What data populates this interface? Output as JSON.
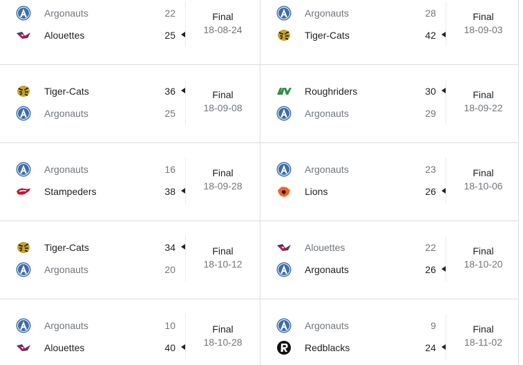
{
  "colors": {
    "divider": "#dadce0",
    "winner_text": "#202124",
    "loser_text": "#70757a",
    "argonauts_blue": "#3b6ea8",
    "alouettes_red": "#c8102e",
    "alouettes_blue": "#2a3b8f",
    "tigercats_gold": "#c9a227",
    "roughriders_green": "#2f8f46",
    "stampeders_red": "#c8102e",
    "lions_orange": "#f26522",
    "redblacks_black": "#111111"
  },
  "games": [
    {
      "status": "Final",
      "date": "18-08-24",
      "teams": [
        {
          "name": "Argonauts",
          "score": "22",
          "logo": "argonauts-logo-icon",
          "winner": false
        },
        {
          "name": "Alouettes",
          "score": "25",
          "logo": "alouettes-logo-icon",
          "winner": true
        }
      ]
    },
    {
      "status": "Final",
      "date": "18-09-03",
      "teams": [
        {
          "name": "Argonauts",
          "score": "28",
          "logo": "argonauts-logo-icon",
          "winner": false
        },
        {
          "name": "Tiger-Cats",
          "score": "42",
          "logo": "tigercats-logo-icon",
          "winner": true
        }
      ]
    },
    {
      "status": "Final",
      "date": "18-09-08",
      "teams": [
        {
          "name": "Tiger-Cats",
          "score": "36",
          "logo": "tigercats-logo-icon",
          "winner": true
        },
        {
          "name": "Argonauts",
          "score": "25",
          "logo": "argonauts-logo-icon",
          "winner": false
        }
      ]
    },
    {
      "status": "Final",
      "date": "18-09-22",
      "teams": [
        {
          "name": "Roughriders",
          "score": "30",
          "logo": "roughriders-logo-icon",
          "winner": true
        },
        {
          "name": "Argonauts",
          "score": "29",
          "logo": "argonauts-logo-icon",
          "winner": false
        }
      ]
    },
    {
      "status": "Final",
      "date": "18-09-28",
      "teams": [
        {
          "name": "Argonauts",
          "score": "16",
          "logo": "argonauts-logo-icon",
          "winner": false
        },
        {
          "name": "Stampeders",
          "score": "38",
          "logo": "stampeders-logo-icon",
          "winner": true
        }
      ]
    },
    {
      "status": "Final",
      "date": "18-10-06",
      "teams": [
        {
          "name": "Argonauts",
          "score": "23",
          "logo": "argonauts-logo-icon",
          "winner": false
        },
        {
          "name": "Lions",
          "score": "26",
          "logo": "lions-logo-icon",
          "winner": true
        }
      ]
    },
    {
      "status": "Final",
      "date": "18-10-12",
      "teams": [
        {
          "name": "Tiger-Cats",
          "score": "34",
          "logo": "tigercats-logo-icon",
          "winner": true
        },
        {
          "name": "Argonauts",
          "score": "20",
          "logo": "argonauts-logo-icon",
          "winner": false
        }
      ]
    },
    {
      "status": "Final",
      "date": "18-10-20",
      "teams": [
        {
          "name": "Alouettes",
          "score": "22",
          "logo": "alouettes-logo-icon",
          "winner": false
        },
        {
          "name": "Argonauts",
          "score": "26",
          "logo": "argonauts-logo-icon",
          "winner": true
        }
      ]
    },
    {
      "status": "Final",
      "date": "18-10-28",
      "teams": [
        {
          "name": "Argonauts",
          "score": "10",
          "logo": "argonauts-logo-icon",
          "winner": false
        },
        {
          "name": "Alouettes",
          "score": "40",
          "logo": "alouettes-logo-icon",
          "winner": true
        }
      ]
    },
    {
      "status": "Final",
      "date": "18-11-02",
      "teams": [
        {
          "name": "Argonauts",
          "score": "9",
          "logo": "argonauts-logo-icon",
          "winner": false
        },
        {
          "name": "Redblacks",
          "score": "24",
          "logo": "redblacks-logo-icon",
          "winner": true
        }
      ]
    }
  ]
}
